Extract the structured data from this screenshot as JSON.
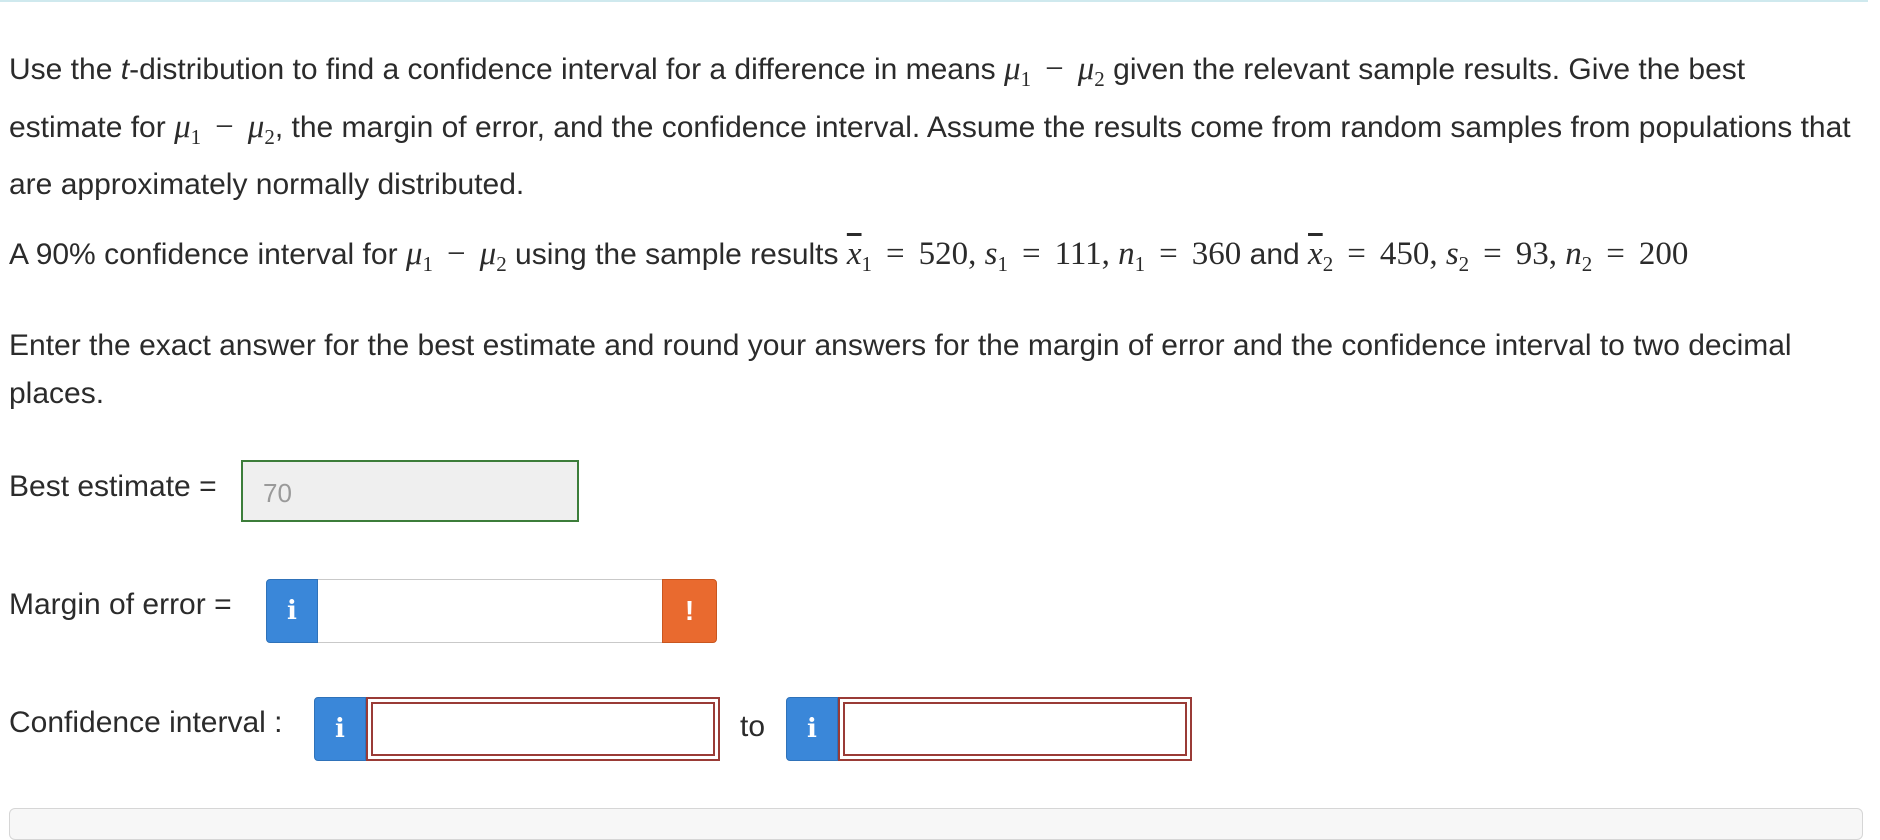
{
  "problem": {
    "intro_1": "Use the ",
    "intro_t": "t",
    "intro_2": "-distribution to find a confidence interval for a difference in means ",
    "intro_3": " given the relevant sample results. Give the best estimate for ",
    "intro_4": ", the margin of error, and the confidence interval. Assume the results come from random samples from populations that are approximately normally distributed.",
    "setup_1": "A 90% confidence interval for ",
    "setup_2": " using the sample results ",
    "setup_and": " and ",
    "instructions": "Enter the exact answer for the best estimate and round your answers for the margin of error and the confidence interval to two decimal places."
  },
  "math": {
    "mu": "μ",
    "sub1": "1",
    "sub2": "2",
    "minus": "−",
    "equals": "=",
    "xbar": "x",
    "s": "s",
    "n": "n",
    "x1": "520",
    "s1": "111",
    "n1": "360",
    "x2": "450",
    "s2": "93",
    "n2": "200",
    "comma": ","
  },
  "form": {
    "best_estimate_label": "Best estimate =",
    "best_estimate_value": "70",
    "margin_label": "Margin of error =",
    "margin_value": "",
    "ci_label": "Confidence interval :",
    "ci_to": "to",
    "ci_lower": "",
    "ci_upper": "",
    "info_glyph": "i",
    "warning_glyph": "!"
  },
  "colors": {
    "info_blue": "#3a87d9",
    "warning_orange": "#e96a2f",
    "correct_green": "#3c7d3a",
    "error_red": "#9a3b36"
  }
}
